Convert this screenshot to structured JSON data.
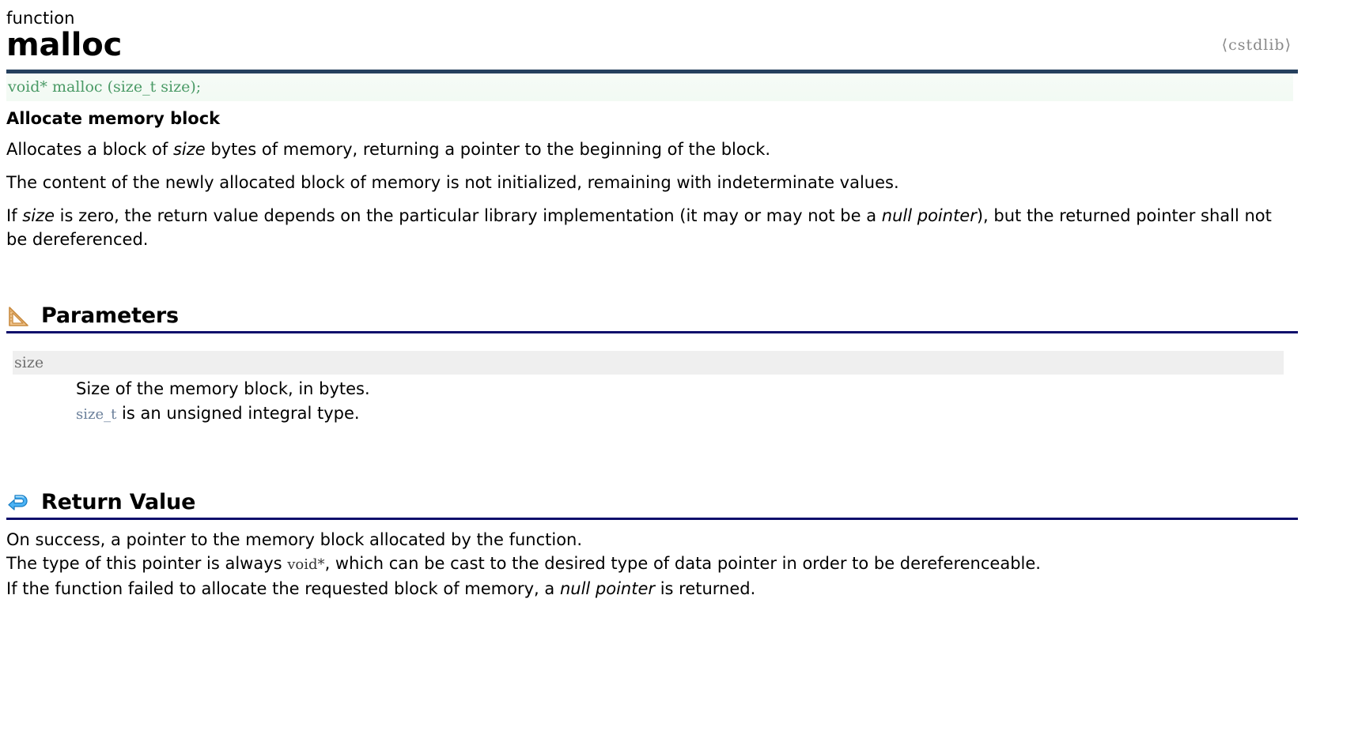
{
  "header": {
    "kind": "function",
    "name": "malloc",
    "header_file": "⟨cstdlib⟩"
  },
  "prototype": {
    "signature": "void* malloc (size_t size);"
  },
  "brief": "Allocate memory block",
  "description": {
    "p1_a": "Allocates a block of ",
    "p1_em": "size",
    "p1_b": " bytes of memory, returning a pointer to the beginning of the block.",
    "p2": "The content of the newly allocated block of memory is not initialized, remaining with indeterminate values.",
    "p3_a": "If ",
    "p3_em": "size",
    "p3_b": " is zero, the return value depends on the particular library implementation (it may or may not be a ",
    "p3_em2": "null pointer",
    "p3_c": "), but the returned pointer shall not be dereferenced."
  },
  "sections": {
    "parameters": {
      "icon": "set-square-ruler-icon",
      "title": "Parameters",
      "params": [
        {
          "name": "size",
          "desc_line1": "Size of the memory block, in bytes.",
          "desc_line2_code": "size_t",
          "desc_line2_text": " is an unsigned integral type."
        }
      ]
    },
    "return_value": {
      "icon": "return-arrow-icon",
      "title": "Return Value",
      "line1": "On success, a pointer to the memory block allocated by the function.",
      "line2_a": "The type of this pointer is always ",
      "line2_code": "void*",
      "line2_b": ", which can be cast to the desired type of data pointer in order to be dereferenceable.",
      "line3_a": "If the function failed to allocate the requested block of memory, a ",
      "line3_em": "null pointer",
      "line3_b": " is returned."
    }
  },
  "colors": {
    "rule_top": "#26405e",
    "section_rule": "#0d0d6b",
    "prototype_text": "#4a9a66",
    "prototype_bg": "#f3fbf3",
    "param_band_bg": "#efefef",
    "param_name_text": "#6f6f6f",
    "code_inline": "#6a7f9a",
    "header_file_text": "#888888",
    "ruler_icon": "#e8b476",
    "return_icon": "#2f9ee8"
  }
}
